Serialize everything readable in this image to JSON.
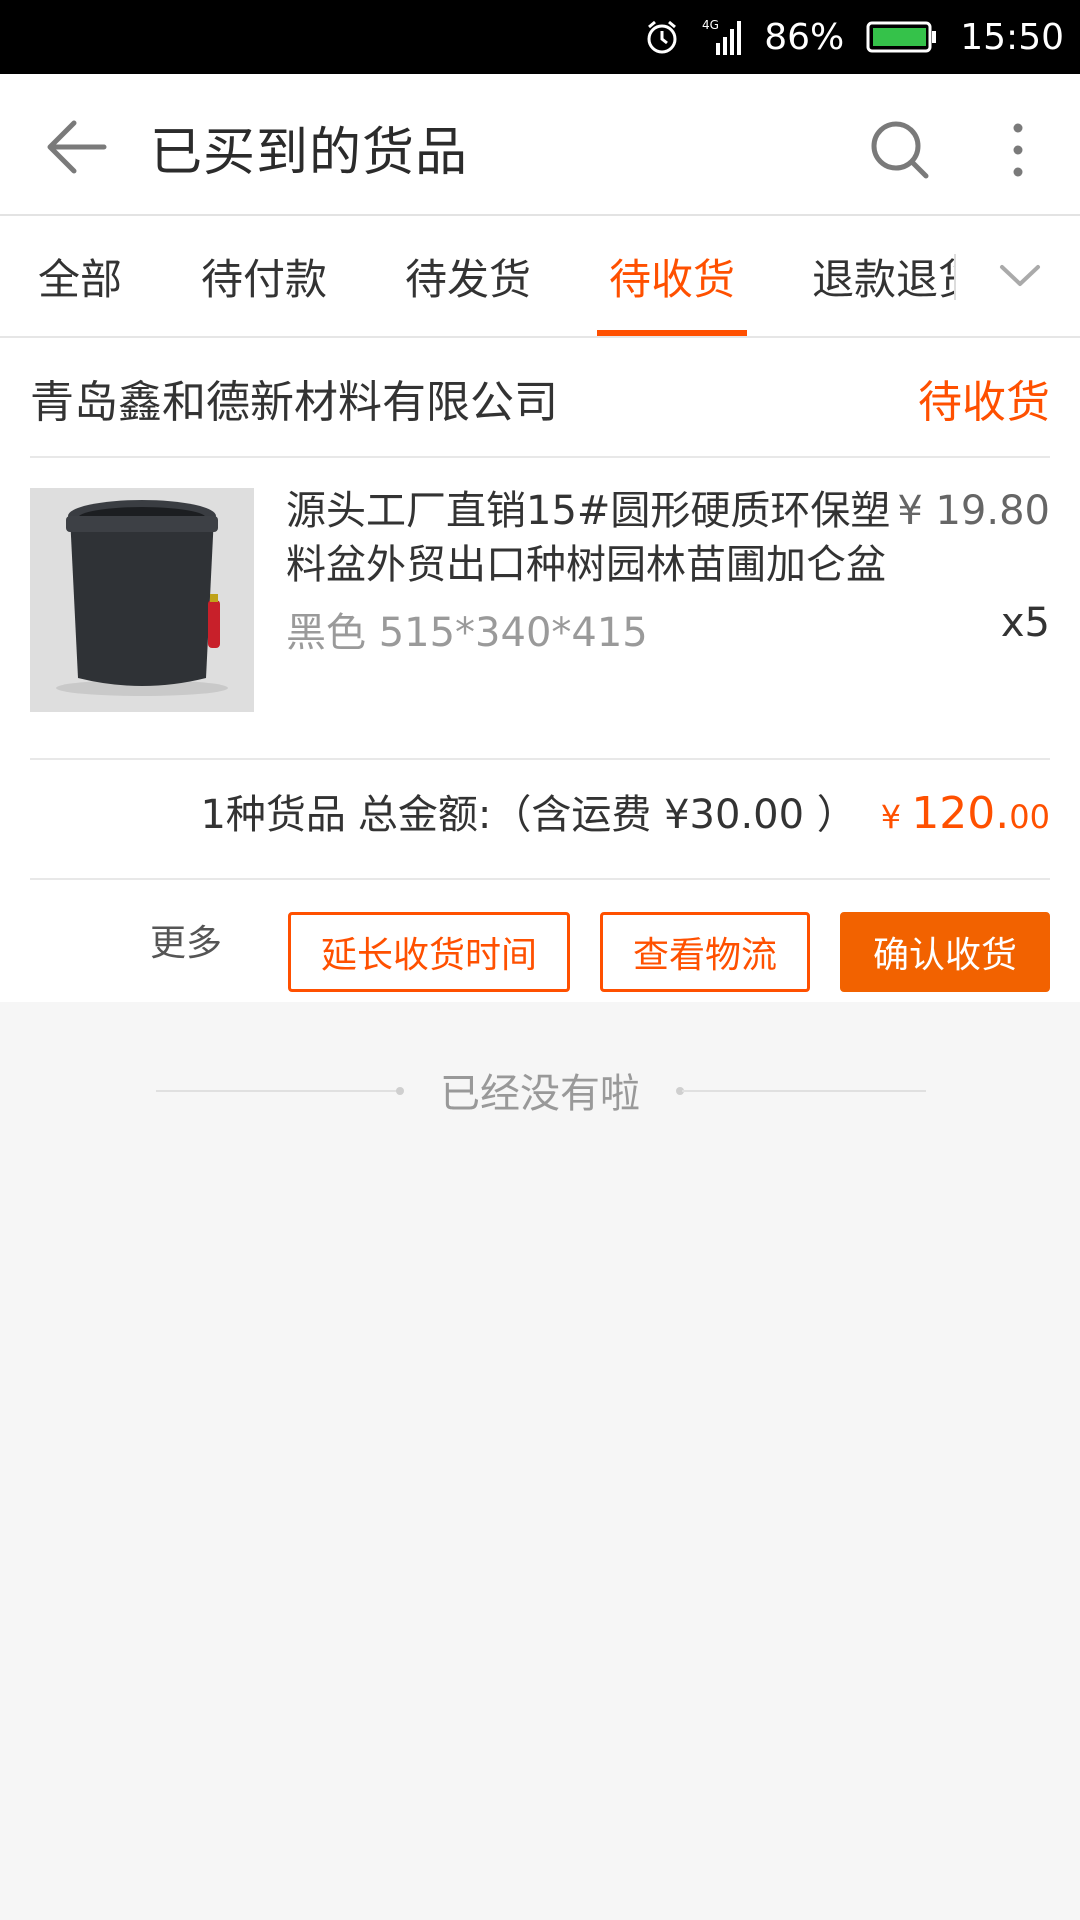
{
  "status_bar": {
    "network": "4G",
    "battery": "86%",
    "time": "15:50",
    "icons": [
      "alarm-icon",
      "signal-icon",
      "battery-icon"
    ]
  },
  "app_bar": {
    "title": "已买到的货品",
    "icons": [
      "back-arrow-icon",
      "search-icon",
      "more-vertical-icon"
    ]
  },
  "tabs": [
    {
      "label": "全部",
      "active": false
    },
    {
      "label": "待付款",
      "active": false
    },
    {
      "label": "待发货",
      "active": false
    },
    {
      "label": "待收货",
      "active": true
    },
    {
      "label": "退款退货",
      "active": false
    }
  ],
  "order": {
    "shop_name": "青岛鑫和德新材料有限公司",
    "status": "待收货",
    "product": {
      "title": "源头工厂直销15#圆形硬质环保塑料盆外贸出口种树园林苗圃加仑盆",
      "price": "¥ 19.80",
      "spec": "黑色 515*340*415",
      "quantity": "x5"
    },
    "summary": {
      "count_text": "1种货品",
      "total_label": "总金额:（含运费 ¥30.00 ）",
      "total_currency": "¥ ",
      "total_integer": "120.",
      "total_decimal": "00"
    },
    "actions": {
      "more": "更多",
      "extend": "延长收货时间",
      "logistics": "查看物流",
      "confirm": "确认收货"
    }
  },
  "end_text": "已经没有啦",
  "colors": {
    "accent": "#ff5000",
    "confirm_button": "#f26200",
    "background": "#f6f6f6"
  }
}
